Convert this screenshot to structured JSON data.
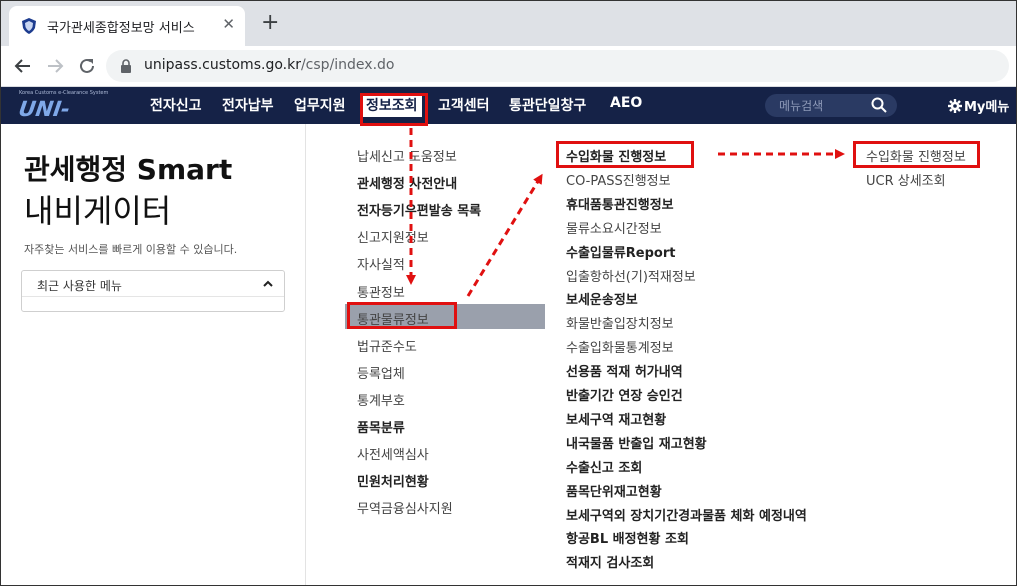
{
  "browser": {
    "tab_title": "국가관세종합정보망 서비스",
    "close_glyph": "✕",
    "new_tab_glyph": "+",
    "url_host": "unipass.customs.go.kr",
    "url_path": "/csp/index.do"
  },
  "header": {
    "logo_small": "Korea Customs e-Clearance System",
    "logo_text": "UNI-PASS",
    "nav": [
      "전자신고",
      "전자납부",
      "업무지원",
      "정보조회",
      "고객센터",
      "통관단일창구",
      "AEO"
    ],
    "active_nav": "정보조회",
    "search_placeholder": "메뉴검색",
    "mymenu": "My메뉴"
  },
  "left_panel": {
    "title_line1": "관세행정 Smart",
    "title_line2": "내비게이터",
    "description": "자주찾는 서비스를 빠르게 이용할 수 있습니다.",
    "recent_menu": "최근 사용한 메뉴"
  },
  "menu_col1": [
    {
      "label": "납세신고 도움정보",
      "bold": false
    },
    {
      "label": "관세행정 사전안내",
      "bold": true
    },
    {
      "label": "전자등기우편발송 목록",
      "bold": true
    },
    {
      "label": "신고지원정보",
      "bold": false
    },
    {
      "label": "자사실적",
      "bold": false
    },
    {
      "label": "통관정보",
      "bold": false
    },
    {
      "label": "통관물류정보",
      "bold": false,
      "selected": true
    },
    {
      "label": "법규준수도",
      "bold": false
    },
    {
      "label": "등록업체",
      "bold": false
    },
    {
      "label": "통계부호",
      "bold": false
    },
    {
      "label": "품목분류",
      "bold": true
    },
    {
      "label": "사전세액심사",
      "bold": false
    },
    {
      "label": "민원처리현황",
      "bold": true
    },
    {
      "label": "무역금융심사지원",
      "bold": false
    }
  ],
  "menu_col2": [
    {
      "label": "수입화물 진행정보",
      "bold": true
    },
    {
      "label": "CO-PASS진행정보",
      "bold": false
    },
    {
      "label": "휴대품통관진행정보",
      "bold": true
    },
    {
      "label": "물류소요시간정보",
      "bold": false
    },
    {
      "label": "수출입물류Report",
      "bold": true
    },
    {
      "label": "입출항하선(기)적재정보",
      "bold": false
    },
    {
      "label": "보세운송정보",
      "bold": true
    },
    {
      "label": "화물반출입장치정보",
      "bold": false
    },
    {
      "label": "수출입화물통계정보",
      "bold": false
    },
    {
      "label": "선용품 적재 허가내역",
      "bold": true
    },
    {
      "label": "반출기간 연장 승인건",
      "bold": true
    },
    {
      "label": "보세구역 재고현황",
      "bold": true
    },
    {
      "label": "내국물품 반출입 재고현황",
      "bold": true
    },
    {
      "label": "수출신고 조회",
      "bold": true
    },
    {
      "label": "품목단위재고현황",
      "bold": true
    },
    {
      "label": "보세구역외 장치기간경과물품 체화 예정내역",
      "bold": true
    },
    {
      "label": "항공BL 배정현황 조회",
      "bold": true
    },
    {
      "label": "적재지 검사조회",
      "bold": true
    }
  ],
  "menu_col3": [
    {
      "label": "수입화물 진행정보"
    },
    {
      "label": "UCR 상세조회"
    }
  ],
  "colors": {
    "header_bg": "#152247",
    "highlight": "#e01010",
    "selected_row": "#9aa0ac"
  }
}
